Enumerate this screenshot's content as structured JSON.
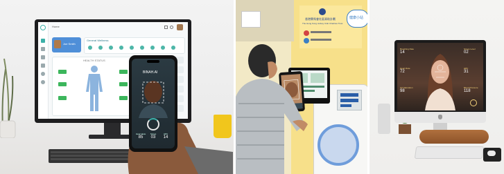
{
  "panels": {
    "dashboard": {
      "header_label": "Home",
      "user_name": "Joe Smith",
      "section_title": "General Wellness",
      "body_heading": "HEALTH STATUS",
      "phone": {
        "brand": "BINAH.AI",
        "readouts": [
          {
            "label": "Heart Rate",
            "value": "85"
          },
          {
            "label": "Stress",
            "value": "03"
          },
          {
            "label": "HRV",
            "value": "14"
          }
        ]
      }
    },
    "kiosk": {
      "sign_title": "香港賽馬會社區資助計劃",
      "sign_subtitle": "The Hong Kong Jockey Club Charities Trust",
      "badge_text": "健康小站"
    },
    "imac": {
      "stats": [
        {
          "label": "Breathing Rate",
          "value": "14"
        },
        {
          "label": "Heart Rate",
          "value": "72"
        },
        {
          "label": "O2 Saturation",
          "value": "98"
        },
        {
          "label": "Stress Level",
          "value": "02"
        },
        {
          "label": "HRV",
          "value": "31"
        },
        {
          "label": "Blood Pressure",
          "value": "118"
        }
      ]
    }
  }
}
